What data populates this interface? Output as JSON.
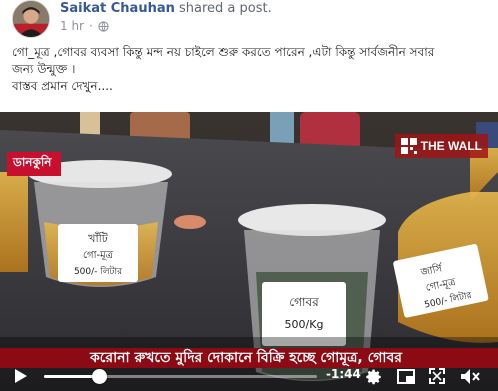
{
  "post": {
    "author_name": "Saikat Chauhan",
    "action": "shared a post.",
    "time": "1 hr",
    "text_lines": [
      "গো_মূত্র ,গোবর ব্যবসা কিন্তু মন্দ নয় চাইলে শুরু করতে পারেন ,এটা কিন্তু সার্বজনীন সবার",
      "জন্য উন্মুক্ত ।",
      "বাস্তব প্রমান দেখুন...."
    ]
  },
  "video": {
    "channel_badge": "ডানকুনি",
    "logo_text": "THE WALL",
    "ticker_text": "করোনা রুখতে মুদির দোকানে বিক্রি হচ্ছে গোমূত্র, গোবর",
    "jar_labels": {
      "left_jar": [
        "খাঁটি",
        "গো-মূত্র",
        "500/- লিটার"
      ],
      "middle_jar": [
        "গোবর",
        "500/Kg"
      ],
      "right_bottle": [
        "জার্সি",
        "গো-মূত্র",
        "500/- লিটার"
      ]
    },
    "time_remaining": "-1:44",
    "progress_fraction": 0.2,
    "icons": {
      "play": "play-icon",
      "settings": "gear-icon",
      "pip": "picture-in-picture-icon",
      "fullscreen": "fullscreen-icon",
      "volume": "volume-icon",
      "privacy": "globe-icon"
    },
    "colors": {
      "author_link": "#385898",
      "ticker_bg": "#8b0a14",
      "badge_bg": "#c8102e"
    }
  }
}
